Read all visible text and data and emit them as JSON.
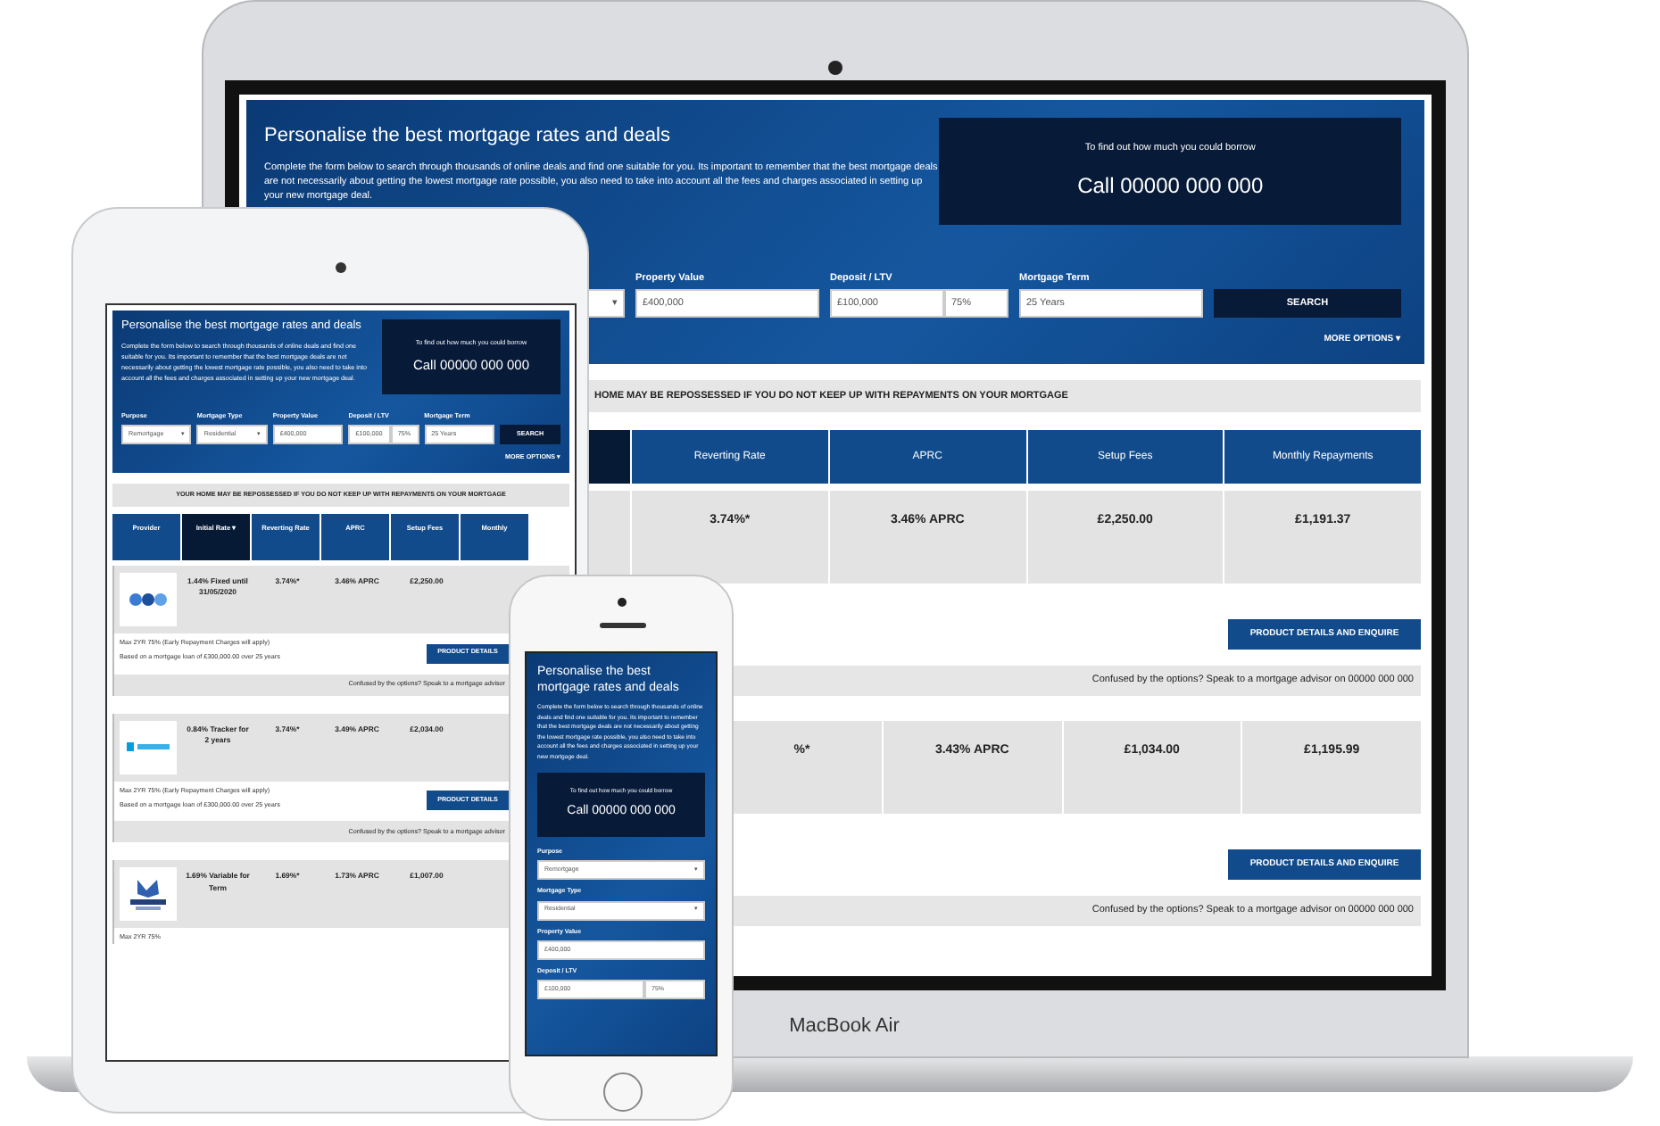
{
  "laptop": {
    "brand": "MacBook Air",
    "screen": {
      "heading": "Personalise the best mortgage rates and deals",
      "intro": "Complete the form below to search through thousands of online deals and find one suitable for you. Its important to remember that the best mortgage deals are not necessarily about getting the lowest mortgage rate possible, you also need to take into account all the fees and charges associated in setting up your new mortgage deal.",
      "borrow": {
        "caption": "To find out how much you could borrow",
        "phone": "Call 00000 000 000"
      },
      "fields": [
        {
          "kind": "stub",
          "caret": "▾"
        },
        {
          "kind": "input",
          "label": "Property Value",
          "value": "£400,000"
        },
        {
          "kind": "split",
          "label": "Deposit / LTV",
          "value": "£100,000",
          "percent": "75%"
        },
        {
          "kind": "input",
          "label": "Mortgage Term",
          "value": "25 Years"
        }
      ],
      "search": "SEARCH",
      "more_options": "MORE OPTIONS ▾",
      "warning": "HOME MAY BE REPOSSESSED IF YOU DO NOT KEEP UP WITH REPAYMENTS ON YOUR MORTGAGE",
      "columns": [
        "Reverting Rate",
        "APRC",
        "Setup Fees",
        "Monthly Repayments"
      ],
      "rows": [
        {
          "cells": [
            "3.74%*",
            "3.46% APRC",
            "£2,250.00",
            "£1,191.37"
          ],
          "button": "PRODUCT DETAILS AND ENQUIRE",
          "advice": "Confused by the options? Speak to a mortgage advisor on 00000 000 000"
        },
        {
          "cells": [
            "%*",
            "3.43% APRC",
            "£1,034.00",
            "£1,195.99"
          ],
          "button": "PRODUCT DETAILS AND ENQUIRE",
          "advice": "Confused by the options? Speak to a mortgage advisor on 00000 000 000"
        }
      ]
    }
  },
  "tablet": {
    "heading": "Personalise the best mortgage rates and deals",
    "intro": "Complete the form below to search through thousands of online deals and find one suitable for you. Its important to remember that the best mortgage deals are not necessarily about getting the lowest mortgage rate possible, you also need to take into account all the fees and charges associated in setting up your new mortgage deal.",
    "borrow": {
      "caption": "To find out how much you could borrow",
      "phone": "Call 00000 000 000"
    },
    "fields": [
      {
        "kind": "select",
        "label": "Purpose",
        "value": "Remortgage",
        "caret": "▾"
      },
      {
        "kind": "select",
        "label": "Mortgage Type",
        "value": "Residential",
        "caret": "▾"
      },
      {
        "kind": "input",
        "label": "Property Value",
        "value": "£400,000"
      },
      {
        "kind": "split",
        "label": "Deposit / LTV",
        "value": "£100,000",
        "percent": "75%"
      },
      {
        "kind": "input",
        "label": "Mortgage Term",
        "value": "25 Years"
      }
    ],
    "search": "SEARCH",
    "more_options": "MORE OPTIONS ▾",
    "warning": "YOUR HOME MAY BE REPOSSESSED IF YOU DO NOT KEEP UP WITH REPAYMENTS ON YOUR MORTGAGE",
    "columns": [
      {
        "label": "Provider",
        "selected": false
      },
      {
        "label": "Initial Rate ▾",
        "selected": true
      },
      {
        "label": "Reverting Rate",
        "selected": false
      },
      {
        "label": "APRC",
        "selected": false
      },
      {
        "label": "Setup Fees",
        "selected": false
      },
      {
        "label": "Monthly",
        "selected": false
      }
    ],
    "rows": [
      {
        "kind": "rings",
        "cells": [
          "",
          "1.44% Fixed until 31/05/2020",
          "3.74%*",
          "3.46% APRC",
          "£2,250.00"
        ],
        "notes": [
          "Max 2YR 75% (Early Repayment Charges will apply)",
          "Based on a mortgage loan of £300,000.00 over 25 years"
        ],
        "button": "PRODUCT DETAILS",
        "advice": "Confused by the options? Speak to a mortgage advisor"
      },
      {
        "kind": "stripes",
        "cells": [
          "",
          "0.84% Tracker for 2 years",
          "3.74%*",
          "3.49% APRC",
          "£2,034.00"
        ],
        "notes": [
          "Max 2YR 75% (Early Repayment Charges will apply)",
          "Based on a mortgage loan of £300,000.00 over 25 years"
        ],
        "button": "PRODUCT DETAILS",
        "advice": "Confused by the options? Speak to a mortgage advisor"
      },
      {
        "kind": "figure",
        "cells": [
          "",
          "1.69% Variable for Term",
          "1.69%*",
          "1.73% APRC",
          "£1,007.00"
        ],
        "notes": [
          "Max 2YR 75%"
        ]
      }
    ]
  },
  "phone": {
    "heading": "Personalise the best mortgage rates and deals",
    "intro": "Complete the form below to search through thousands of online deals and find one suitable for you. Its important to remember that the best mortgage deals are not necessarily about getting the lowest mortgage rate possible, you also need to take into account all the fees and charges associated in setting up your new mortgage deal.",
    "borrow": {
      "caption": "To find out how much you could borrow",
      "phone": "Call 00000 000 000"
    },
    "fields": [
      {
        "kind": "select",
        "label": "Purpose",
        "value": "Remortgage",
        "caret": "▾"
      },
      {
        "kind": "select",
        "label": "Mortgage Type",
        "value": "Residential",
        "caret": "▾"
      },
      {
        "kind": "input",
        "label": "Property Value",
        "value": "£400,000"
      },
      {
        "kind": "split",
        "label": "Deposit / LTV",
        "value": "£100,000",
        "percent": "75%"
      }
    ]
  }
}
